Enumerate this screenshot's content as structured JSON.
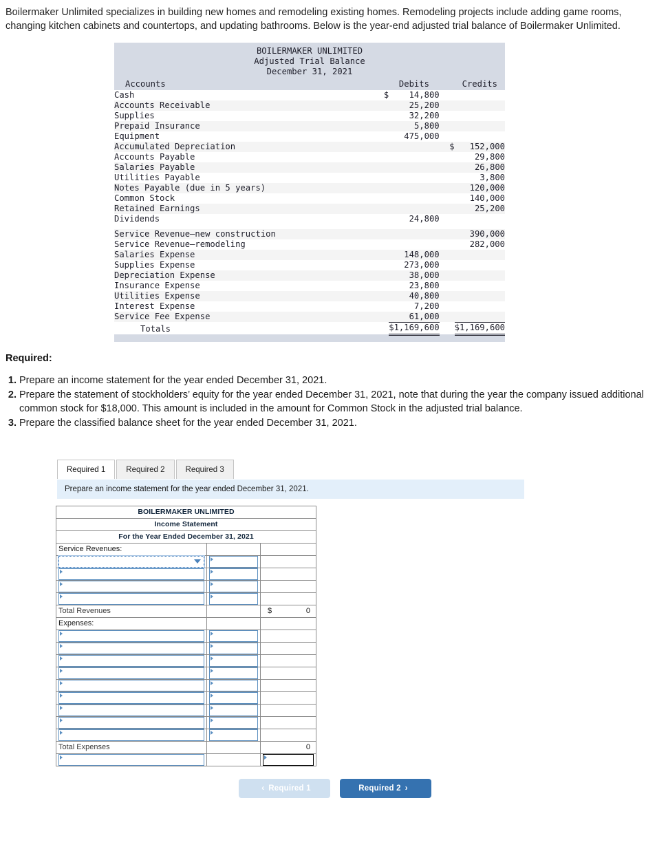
{
  "intro": "Boilermaker Unlimited specializes in building new homes and remodeling existing homes. Remodeling projects include adding game rooms, changing kitchen cabinets and countertops, and updating bathrooms. Below is the year-end adjusted trial balance of Boilermaker Unlimited.",
  "trial_balance": {
    "company": "BOILERMAKER UNLIMITED",
    "statement": "Adjusted Trial Balance",
    "date": "December 31, 2021",
    "headers": {
      "accounts": "Accounts",
      "debits": "Debits",
      "credits": "Credits"
    },
    "rows": [
      {
        "account": "Cash",
        "debit_symbol": "$",
        "debit": "14,800",
        "credit_symbol": "",
        "credit": ""
      },
      {
        "account": "Accounts Receivable",
        "debit_symbol": "",
        "debit": "25,200",
        "credit_symbol": "",
        "credit": ""
      },
      {
        "account": "Supplies",
        "debit_symbol": "",
        "debit": "32,200",
        "credit_symbol": "",
        "credit": ""
      },
      {
        "account": "Prepaid Insurance",
        "debit_symbol": "",
        "debit": "5,800",
        "credit_symbol": "",
        "credit": ""
      },
      {
        "account": "Equipment",
        "debit_symbol": "",
        "debit": "475,000",
        "credit_symbol": "",
        "credit": ""
      },
      {
        "account": "Accumulated Depreciation",
        "debit_symbol": "",
        "debit": "",
        "credit_symbol": "$",
        "credit": "152,000"
      },
      {
        "account": "Accounts Payable",
        "debit_symbol": "",
        "debit": "",
        "credit_symbol": "",
        "credit": "29,800"
      },
      {
        "account": "Salaries Payable",
        "debit_symbol": "",
        "debit": "",
        "credit_symbol": "",
        "credit": "26,800"
      },
      {
        "account": "Utilities Payable",
        "debit_symbol": "",
        "debit": "",
        "credit_symbol": "",
        "credit": "3,800"
      },
      {
        "account": "Notes Payable (due in 5 years)",
        "debit_symbol": "",
        "debit": "",
        "credit_symbol": "",
        "credit": "120,000"
      },
      {
        "account": "Common Stock",
        "debit_symbol": "",
        "debit": "",
        "credit_symbol": "",
        "credit": "140,000"
      },
      {
        "account": "Retained Earnings",
        "debit_symbol": "",
        "debit": "",
        "credit_symbol": "",
        "credit": "25,200"
      },
      {
        "account": "Dividends",
        "debit_symbol": "",
        "debit": "24,800",
        "credit_symbol": "",
        "credit": ""
      },
      {
        "account": "Service Revenue—new construction",
        "debit_symbol": "",
        "debit": "",
        "credit_symbol": "",
        "credit": "390,000"
      },
      {
        "account": "Service Revenue—remodeling",
        "debit_symbol": "",
        "debit": "",
        "credit_symbol": "",
        "credit": "282,000"
      },
      {
        "account": "Salaries Expense",
        "debit_symbol": "",
        "debit": "148,000",
        "credit_symbol": "",
        "credit": ""
      },
      {
        "account": "Supplies Expense",
        "debit_symbol": "",
        "debit": "273,000",
        "credit_symbol": "",
        "credit": ""
      },
      {
        "account": "Depreciation Expense",
        "debit_symbol": "",
        "debit": "38,000",
        "credit_symbol": "",
        "credit": ""
      },
      {
        "account": "Insurance Expense",
        "debit_symbol": "",
        "debit": "23,800",
        "credit_symbol": "",
        "credit": ""
      },
      {
        "account": "Utilities Expense",
        "debit_symbol": "",
        "debit": "40,800",
        "credit_symbol": "",
        "credit": ""
      },
      {
        "account": "Interest Expense",
        "debit_symbol": "",
        "debit": "7,200",
        "credit_symbol": "",
        "credit": ""
      },
      {
        "account": "Service Fee Expense",
        "debit_symbol": "",
        "debit": "61,000",
        "credit_symbol": "",
        "credit": ""
      }
    ],
    "totals": {
      "label": "Totals",
      "debit": "$1,169,600",
      "credit": "$1,169,600"
    }
  },
  "required": {
    "heading": "Required:",
    "items": [
      {
        "num": "1.",
        "text": "Prepare an income statement for the year ended December 31, 2021."
      },
      {
        "num": "2.",
        "text": "Prepare the statement of stockholders’ equity for the year ended December 31, 2021, note that during the year the company issued additional common stock for $18,000. This amount is included in the amount for Common Stock in the adjusted trial balance."
      },
      {
        "num": "3.",
        "text": "Prepare the classified balance sheet for the year ended December 31, 2021."
      }
    ]
  },
  "tabs": [
    {
      "label": "Required 1",
      "active": true
    },
    {
      "label": "Required 2",
      "active": false
    },
    {
      "label": "Required 3",
      "active": false
    }
  ],
  "tab_instruction": "Prepare an income statement for the year ended December 31, 2021.",
  "worksheet": {
    "title_line1": "BOILERMAKER UNLIMITED",
    "title_line2": "Income Statement",
    "title_line3": "For the Year Ended December 31, 2021",
    "revenue_section_label": "Service Revenues:",
    "total_revenues_label": "Total Revenues",
    "total_revenues_symbol": "$",
    "total_revenues_value": "0",
    "expenses_section_label": "Expenses:",
    "total_expenses_label": "Total Expenses",
    "total_expenses_value": "0",
    "revenue_input_rows": 4,
    "expense_input_rows": 9
  },
  "nav": {
    "prev_label": "Required 1",
    "prev_chevron": "‹",
    "next_label": "Required 2",
    "next_chevron": "›"
  },
  "colors": {
    "tb_band": "#d5dae4",
    "ws_header": "#6fa8dc",
    "instruction_band": "#e3effa",
    "next_button": "#3572b0",
    "prev_button": "#cfe0f0"
  }
}
